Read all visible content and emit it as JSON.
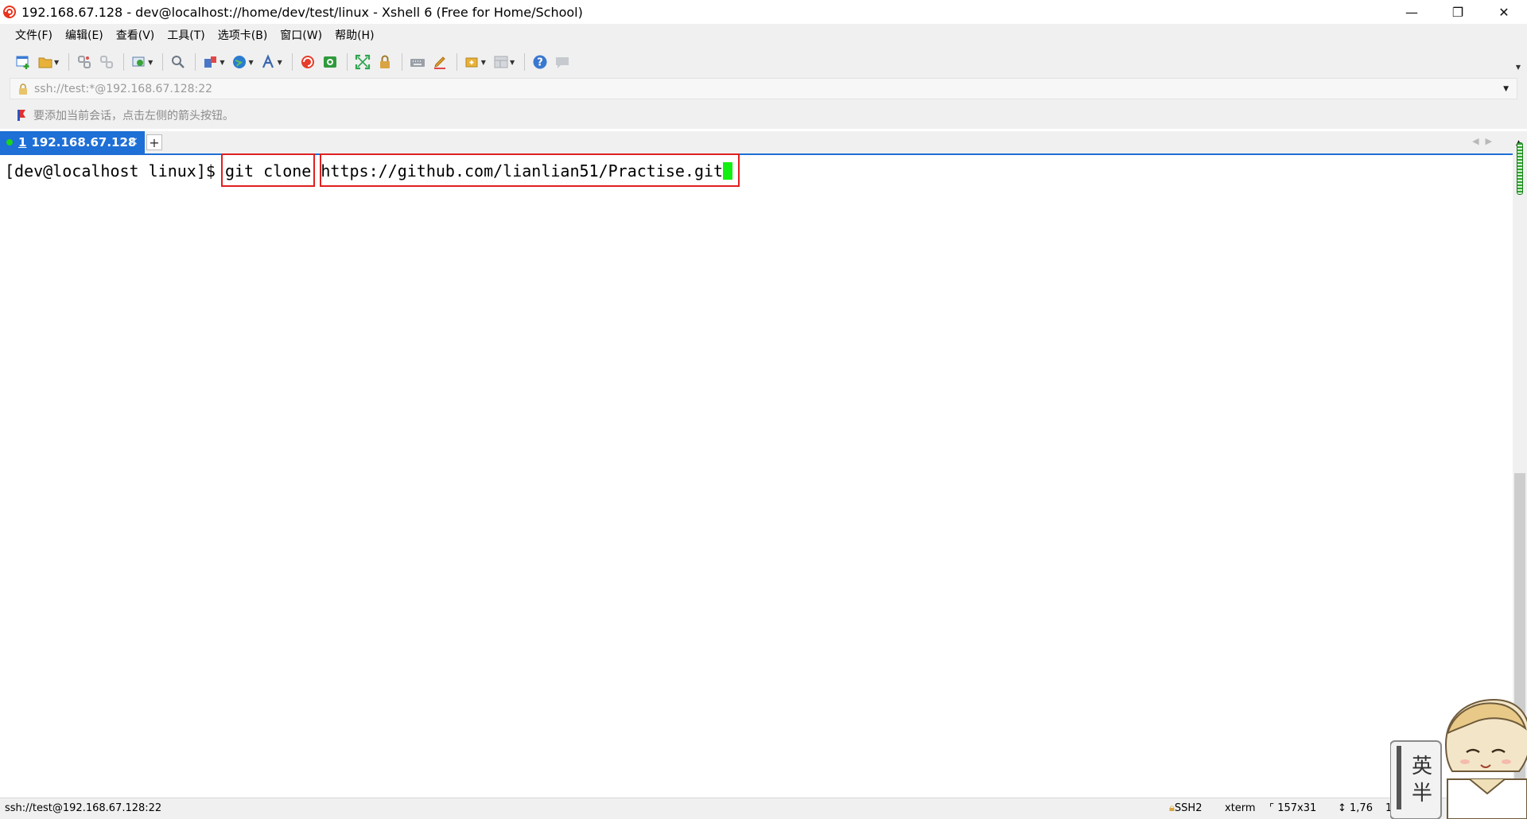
{
  "window": {
    "title": "192.168.67.128 - dev@localhost://home/dev/test/linux - Xshell 6 (Free for Home/School)",
    "minimize_glyph": "—",
    "restore_glyph": "❐",
    "close_glyph": "✕"
  },
  "menu": {
    "items": [
      "文件(F)",
      "编辑(E)",
      "查看(V)",
      "工具(T)",
      "选项卡(B)",
      "窗口(W)",
      "帮助(H)"
    ]
  },
  "toolbar": {
    "icons": [
      "new-session-icon",
      "open-folder-icon",
      "link-icon",
      "unlink-icon",
      "properties-icon",
      "search-icon",
      "transfer-icon",
      "globe-icon",
      "font-icon",
      "xftp-icon",
      "xmanager-icon",
      "fullscreen-icon",
      "lock-icon",
      "keyboard-icon",
      "highlight-icon",
      "compose-icon",
      "layout-icon",
      "help-icon",
      "chat-icon"
    ]
  },
  "address": {
    "value": "ssh://test:*@192.168.67.128:22"
  },
  "hint": {
    "text": "要添加当前会话，点击左侧的箭头按钮。"
  },
  "tabs": {
    "active": {
      "number": "1",
      "label": "192.168.67.128",
      "status_color": "#19d619"
    },
    "close_glyph": "×",
    "add_glyph": "+",
    "nav_glyphs": "◀▶"
  },
  "terminal": {
    "prompt": "[dev@localhost linux]$ ",
    "command": "git clone",
    "space": " ",
    "argument": "https://github.com/lianlian51/Practise.git",
    "cursor_color": "#11f011",
    "highlight_color": "#e02020"
  },
  "status": {
    "connection": "ssh://test@192.168.67.128:22",
    "protocol": "SSH2",
    "terminal_type": "xterm",
    "size": "157x31",
    "position": "1,76",
    "sessions": "1"
  },
  "sticker": {
    "chars": [
      "英",
      "半"
    ]
  },
  "colors": {
    "accent": "#1e6fd6",
    "chrome": "#f0f0f0"
  }
}
